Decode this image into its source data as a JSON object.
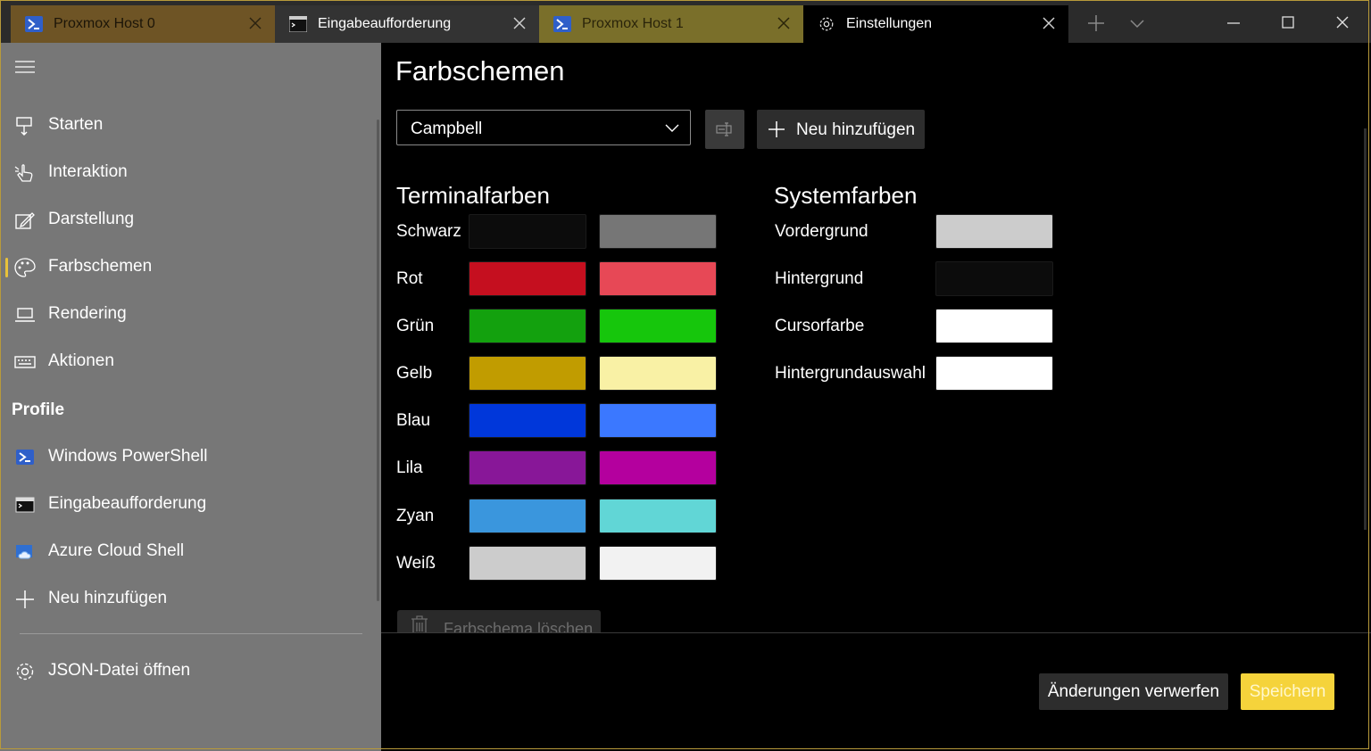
{
  "tabs": [
    {
      "title": "Proxmox Host 0",
      "icon": "powershell-icon",
      "color": "#6e5425"
    },
    {
      "title": "Eingabeaufforderung",
      "icon": "cmd-icon",
      "color": "#333333"
    },
    {
      "title": "Proxmox Host 1",
      "icon": "powershell-icon",
      "color": "#7a6f2a"
    },
    {
      "title": "Einstellungen",
      "icon": "gear-icon",
      "color": "#000000",
      "active": true
    }
  ],
  "sidebar": {
    "items": [
      {
        "label": "Starten",
        "icon": "startup-icon"
      },
      {
        "label": "Interaktion",
        "icon": "pointer-icon"
      },
      {
        "label": "Darstellung",
        "icon": "edit-icon"
      },
      {
        "label": "Farbschemen",
        "icon": "palette-icon",
        "selected": true
      },
      {
        "label": "Rendering",
        "icon": "laptop-icon"
      },
      {
        "label": "Aktionen",
        "icon": "keyboard-icon"
      }
    ],
    "profiles_header": "Profile",
    "profiles": [
      {
        "label": "Windows PowerShell",
        "icon": "powershell-icon"
      },
      {
        "label": "Eingabeaufforderung",
        "icon": "cmd-icon"
      },
      {
        "label": "Azure Cloud Shell",
        "icon": "azure-icon"
      },
      {
        "label": "Neu hinzufügen",
        "icon": "plus-icon"
      }
    ],
    "open_json": {
      "label": "JSON-Datei öffnen",
      "icon": "gear-icon"
    }
  },
  "main": {
    "title": "Farbschemen",
    "scheme_select": {
      "value": "Campbell"
    },
    "add_new_label": "Neu hinzufügen",
    "terminal_colors": {
      "title": "Terminalfarben",
      "rows": [
        {
          "label": "Schwarz",
          "normal": "#0c0c0c",
          "bright": "#767676"
        },
        {
          "label": "Rot",
          "normal": "#c50f1f",
          "bright": "#e74856"
        },
        {
          "label": "Grün",
          "normal": "#13a10e",
          "bright": "#16c60c"
        },
        {
          "label": "Gelb",
          "normal": "#c19c00",
          "bright": "#f9f1a5"
        },
        {
          "label": "Blau",
          "normal": "#0037da",
          "bright": "#3b78ff"
        },
        {
          "label": "Lila",
          "normal": "#881798",
          "bright": "#b4009e"
        },
        {
          "label": "Zyan",
          "normal": "#3a96dd",
          "bright": "#61d6d6"
        },
        {
          "label": "Weiß",
          "normal": "#cccccc",
          "bright": "#f2f2f2"
        }
      ]
    },
    "system_colors": {
      "title": "Systemfarben",
      "rows": [
        {
          "label": "Vordergrund",
          "color": "#cccccc"
        },
        {
          "label": "Hintergrund",
          "color": "#0c0c0c"
        },
        {
          "label": "Cursorfarbe",
          "color": "#ffffff"
        },
        {
          "label": "Hintergrundauswahl",
          "color": "#ffffff"
        }
      ]
    },
    "delete_label": "Farbschema löschen"
  },
  "footer": {
    "discard_label": "Änderungen verwerfen",
    "save_label": "Speichern"
  },
  "colors": {
    "accent": "#f5d33b",
    "sidebar_bg": "#777777",
    "main_bg": "#000000"
  }
}
